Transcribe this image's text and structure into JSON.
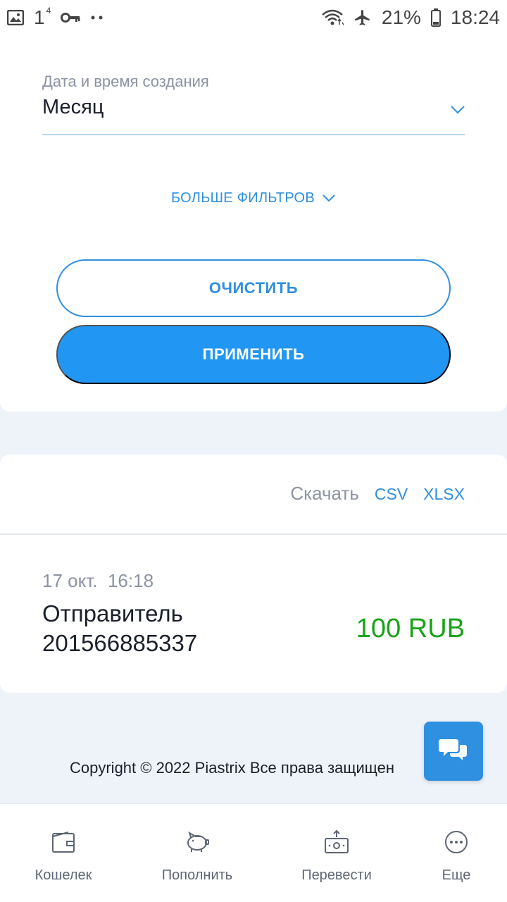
{
  "status_bar": {
    "notification_count": "1",
    "notification_sup": "4",
    "battery": "21%",
    "time": "18:24",
    "icons": [
      "image-icon",
      "key-icon",
      "dots-icon",
      "wifi-icon",
      "airplane-icon",
      "battery-icon"
    ]
  },
  "filter": {
    "date_label": "Дата и время создания",
    "date_value": "Месяц",
    "more_filters": "БОЛЬШЕ ФИЛЬТРОВ",
    "clear_button": "ОЧИСТИТЬ",
    "apply_button": "ПРИМЕНИТЬ"
  },
  "results": {
    "download_label": "Скачать",
    "csv": "CSV",
    "xlsx": "XLSX",
    "transactions": [
      {
        "date": "17 окт.  16:18",
        "sender_line1": "Отправитель",
        "sender_line2": "201566885337",
        "amount": "100 RUB"
      }
    ]
  },
  "footer": {
    "copyright": "Copyright © 2022 Piastrix Все права защищен"
  },
  "bottom_nav": {
    "items": [
      {
        "label": "Кошелек",
        "icon": "wallet-icon"
      },
      {
        "label": "Пополнить",
        "icon": "piggy-bank-icon"
      },
      {
        "label": "Перевести",
        "icon": "transfer-icon"
      },
      {
        "label": "Еще",
        "icon": "more-icon"
      }
    ]
  },
  "colors": {
    "accent": "#2f8fe0",
    "apply_bg": "#2196f3",
    "amount_positive": "#17a317",
    "page_bg": "#eef3f9"
  }
}
